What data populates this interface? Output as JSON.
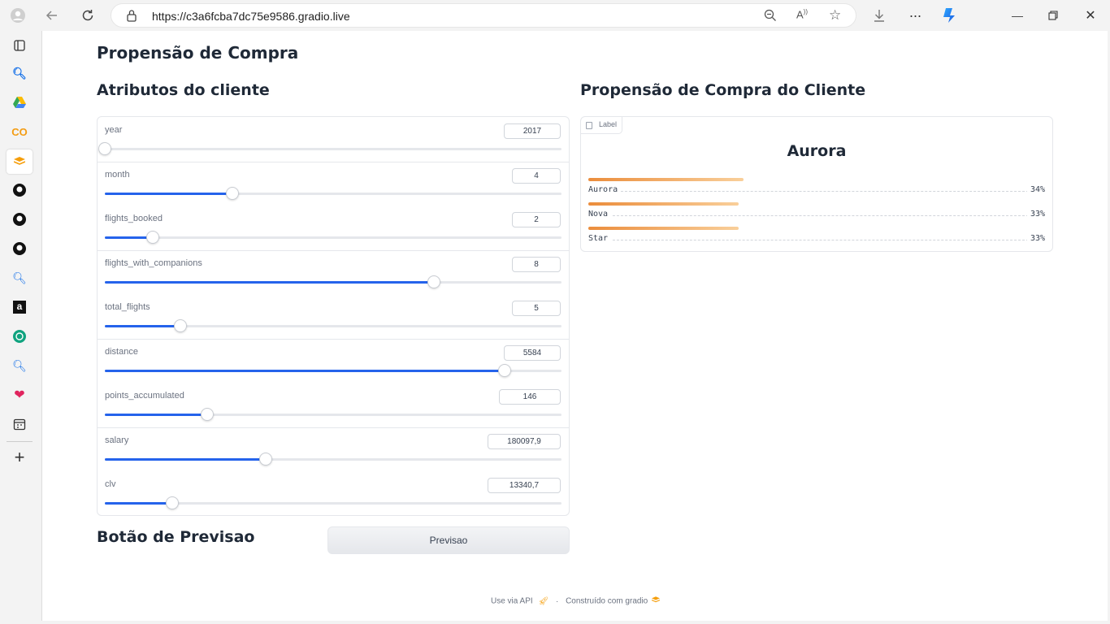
{
  "browser": {
    "url": "https://c3a6fcba7dc75e9586.gradio.live"
  },
  "page": {
    "title": "Propensão de Compra",
    "left_heading": "Atributos do cliente",
    "right_heading": "Propensão de Compra do Cliente",
    "button_heading": "Botão de Previsao",
    "button_label": "Previsao"
  },
  "sliders": [
    {
      "label": "year",
      "value": "2017",
      "fraction": 0.0
    },
    {
      "label": "month",
      "value": "4",
      "fraction": 0.28
    },
    {
      "label": "flights_booked",
      "value": "2",
      "fraction": 0.105
    },
    {
      "label": "flights_with_companions",
      "value": "8",
      "fraction": 0.72
    },
    {
      "label": "total_flights",
      "value": "5",
      "fraction": 0.165
    },
    {
      "label": "distance",
      "value": "5584",
      "fraction": 0.875
    },
    {
      "label": "points_accumulated",
      "value": "146",
      "fraction": 0.225
    },
    {
      "label": "salary",
      "value": "180097,9",
      "fraction": 0.352
    },
    {
      "label": "clv",
      "value": "13340,7",
      "fraction": 0.148
    }
  ],
  "label_output": {
    "tag": "Label",
    "top_label": "Aurora",
    "confidences": [
      {
        "name": "Aurora",
        "pct": "34%",
        "value": 0.34
      },
      {
        "name": "Nova",
        "pct": "33%",
        "value": 0.33
      },
      {
        "name": "Star",
        "pct": "33%",
        "value": 0.33
      }
    ]
  },
  "footer": {
    "api": "Use via API",
    "sep": "·",
    "built": "Construído com gradio"
  }
}
